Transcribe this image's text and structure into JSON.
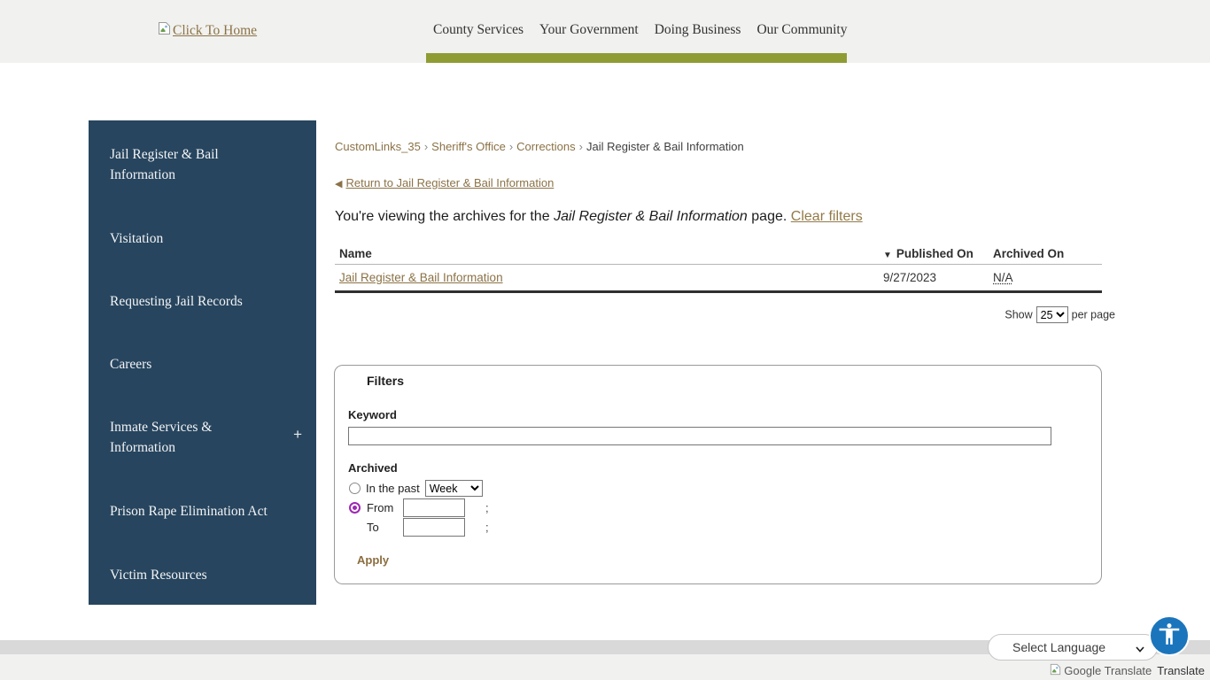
{
  "header": {
    "home_link_label": "Click To Home",
    "nav_items": [
      "County Services",
      "Your Government",
      "Doing Business",
      "Our Community"
    ]
  },
  "sidebar": {
    "items": [
      "Jail Register & Bail Information",
      "Visitation",
      "Requesting Jail Records",
      "Careers",
      "Inmate Services & Information",
      "Prison Rape Elimination Act",
      "Victim Resources"
    ],
    "expander_symbol": "+"
  },
  "breadcrumb": {
    "links": [
      "CustomLinks_35",
      "Sheriff's Office",
      "Corrections"
    ],
    "separator": "›",
    "current": "Jail Register & Bail Information"
  },
  "return_link": {
    "arrow": "◀",
    "label": "Return to Jail Register & Bail Information"
  },
  "archive_banner": {
    "prefix": "You're viewing the archives for the",
    "page_name": "Jail Register & Bail Information",
    "suffix": "page.",
    "clear_link": "Clear filters"
  },
  "table": {
    "sort_indicator": "▼",
    "columns": {
      "name": "Name",
      "published": "Published On",
      "archived": "Archived On"
    },
    "rows": [
      {
        "name": "Jail Register & Bail Information",
        "published": "9/27/2023",
        "archived": "N/A"
      }
    ]
  },
  "pagination": {
    "show_label": "Show",
    "per_page_value": "25",
    "per_page_label": "per page"
  },
  "filters": {
    "title": "Filters",
    "keyword_label": "Keyword",
    "keyword_value": "",
    "archived_label": "Archived",
    "in_the_past_label": "In the past",
    "period_value": "Week",
    "from_label": "From",
    "to_label": "To",
    "separator": ";",
    "apply_label": "Apply"
  },
  "footer": {
    "language_selector": "Select Language",
    "translate_attribution": "Google Translate",
    "translate_label": "Translate"
  },
  "colors": {
    "accent_olive": "#8f9c33",
    "sidebar_blue": "#27455e",
    "link_brown": "#8b7246",
    "accessibility_blue": "#1b75bc",
    "radio_accent": "#9e28b4",
    "header_gray": "#f1f1ef"
  }
}
